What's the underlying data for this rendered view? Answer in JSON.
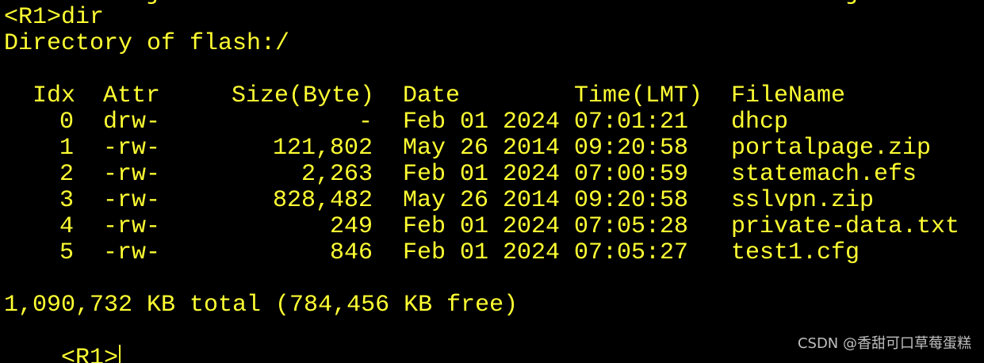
{
  "terminal": {
    "command_line": "<R1>dir",
    "heading": "Directory of flash:/",
    "columns": {
      "idx": "Idx",
      "attr": "Attr",
      "size": "Size(Byte)",
      "date": "Date",
      "time": "Time(LMT)",
      "filename": "FileName"
    },
    "rows": [
      {
        "idx": "0",
        "attr": "drw-",
        "size": "-",
        "date": "Feb 01 2024",
        "time": "07:01:21",
        "filename": "dhcp"
      },
      {
        "idx": "1",
        "attr": "-rw-",
        "size": "121,802",
        "date": "May 26 2014",
        "time": "09:20:58",
        "filename": "portalpage.zip"
      },
      {
        "idx": "2",
        "attr": "-rw-",
        "size": "2,263",
        "date": "Feb 01 2024",
        "time": "07:00:59",
        "filename": "statemach.efs"
      },
      {
        "idx": "3",
        "attr": "-rw-",
        "size": "828,482",
        "date": "May 26 2014",
        "time": "09:20:58",
        "filename": "sslvpn.zip"
      },
      {
        "idx": "4",
        "attr": "-rw-",
        "size": "249",
        "date": "Feb 01 2024",
        "time": "07:05:28",
        "filename": "private-data.txt"
      },
      {
        "idx": "5",
        "attr": "-rw-",
        "size": "846",
        "date": "Feb 01 2024",
        "time": "07:05:27",
        "filename": "test1.cfg"
      }
    ],
    "summary": "1,090,732 KB total (784,456 KB free)",
    "prompt": "<R1>"
  },
  "watermark": "CSDN @香甜可口草莓蛋糕",
  "colors": {
    "background": "#000000",
    "text": "#ffff33",
    "watermark": "#bfbfbf"
  }
}
